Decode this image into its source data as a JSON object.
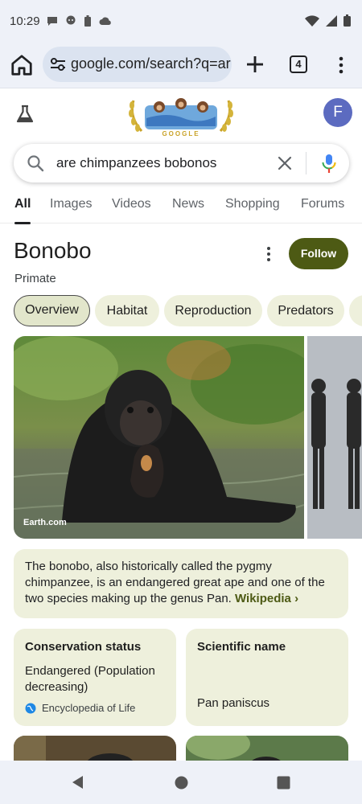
{
  "status_bar": {
    "time": "10:29"
  },
  "toolbar": {
    "url": "google.com/search?q=ar",
    "tab_count": "4"
  },
  "header": {
    "avatar_letter": "F"
  },
  "search": {
    "query": "are chimpanzees bobonos"
  },
  "tabs": [
    "All",
    "Images",
    "Videos",
    "News",
    "Shopping",
    "Forums"
  ],
  "entity": {
    "title": "Bonobo",
    "subtitle": "Primate",
    "follow_label": "Follow"
  },
  "chips": [
    "Overview",
    "Habitat",
    "Reproduction",
    "Predators"
  ],
  "images": {
    "main_credit": "Earth.com"
  },
  "description": {
    "text": "The bonobo, also historically called the pygmy chimpanzee, is an endangered great ape and one of the two species making up the genus Pan.",
    "source": "Wikipedia",
    "source_arrow": "›"
  },
  "facts": [
    {
      "title": "Conservation status",
      "value": "Endangered (Population decreasing)",
      "source": "Encyclopedia of Life"
    },
    {
      "title": "Scientific name",
      "value": "Pan paniscus"
    }
  ],
  "colors": {
    "accent": "#4d5a14",
    "chip_bg": "#eef0dc",
    "avatar": "#5c6bc0",
    "chrome_bg": "#eef1f8"
  }
}
